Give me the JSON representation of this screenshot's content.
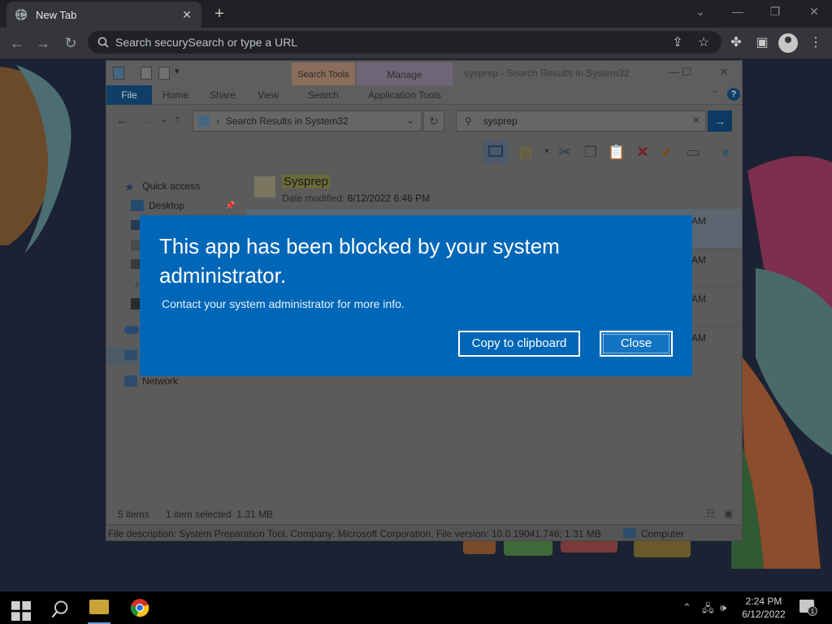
{
  "browser": {
    "tab_title": "New Tab",
    "omnibox_placeholder": "Search securySearch or type a URL",
    "icons": [
      "globe-icon",
      "close-icon",
      "plus-icon",
      "back-icon",
      "forward-icon",
      "reload-icon",
      "search-icon",
      "share-icon",
      "star-icon",
      "extensions-icon",
      "sidepanel-icon",
      "profile-icon"
    ]
  },
  "explorer": {
    "window_title": "sysprep - Search Results in System32",
    "context_tabs": {
      "search_tools": "Search Tools",
      "manage": "Manage"
    },
    "ribbon_tabs": [
      "File",
      "Home",
      "Share",
      "View",
      "Search",
      "Application Tools"
    ],
    "address": "Search Results in System32",
    "search_value": "sysprep",
    "nav": [
      {
        "label": "Quick access"
      },
      {
        "label": "Desktop"
      },
      {
        "label": "Network"
      }
    ],
    "results": {
      "first_name": "Sysprep",
      "first_meta_label": "Date modified:",
      "first_meta_value": "6/12/2022 6:46 PM",
      "time_suffix": "AM"
    },
    "status": {
      "items": "5 items",
      "selected": "1 item selected  1.31 MB"
    },
    "details": {
      "description": "File description: System Preparation Tool, Company: Microsoft Corporation, File version: 10.0.19041.746; 1.31 MB",
      "location": "Computer"
    }
  },
  "dialog": {
    "title": "This app has been blocked by your system administrator.",
    "message": "Contact your system administrator for more info.",
    "copy_label": "Copy to clipboard",
    "close_label": "Close"
  },
  "taskbar": {
    "time": "2:24 PM",
    "date": "6/12/2022",
    "notifications": "1"
  },
  "colors": {
    "dialog_blue": "#0067b8",
    "chrome_dark": "#202124",
    "taskbar": "#000000"
  }
}
